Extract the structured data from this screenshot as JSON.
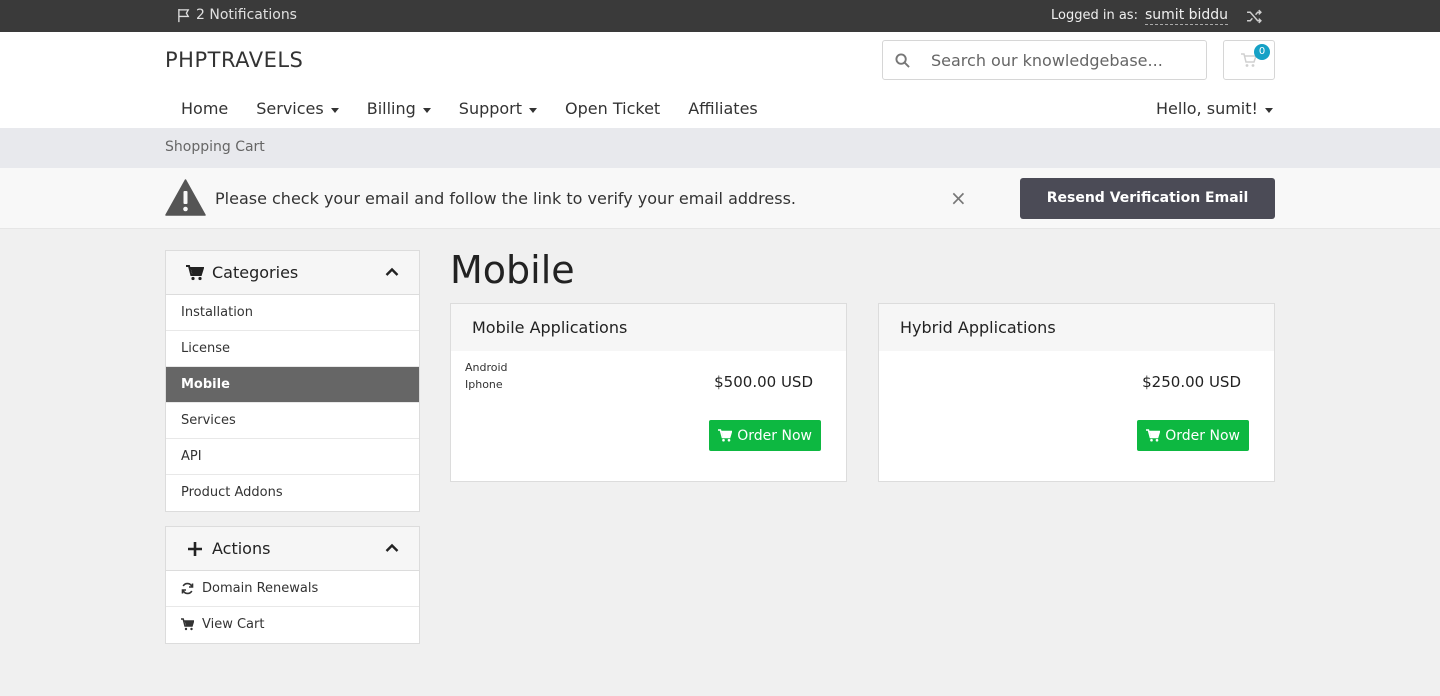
{
  "topbar": {
    "notifications": "2 Notifications",
    "logged_label": "Logged in as:",
    "user": "sumit biddu"
  },
  "header": {
    "brand": "PHPTRAVELS",
    "search_placeholder": "Search our knowledgebase...",
    "cart_count": "0",
    "nav": [
      {
        "label": "Home",
        "dropdown": false
      },
      {
        "label": "Services",
        "dropdown": true
      },
      {
        "label": "Billing",
        "dropdown": true
      },
      {
        "label": "Support",
        "dropdown": true
      },
      {
        "label": "Open Ticket",
        "dropdown": false
      },
      {
        "label": "Affiliates",
        "dropdown": false
      }
    ],
    "hello": "Hello, sumit!"
  },
  "breadcrumb": "Shopping Cart",
  "alert": {
    "text": "Please check your email and follow the link to verify your email address.",
    "close": "×",
    "button": "Resend Verification Email"
  },
  "sidebar": {
    "categories": {
      "title": "Categories",
      "items": [
        "Installation",
        "License",
        "Mobile",
        "Services",
        "API",
        "Product Addons"
      ],
      "active": "Mobile"
    },
    "actions": {
      "title": "Actions",
      "items": [
        {
          "label": "Domain Renewals",
          "icon": "refresh-icon"
        },
        {
          "label": "View Cart",
          "icon": "cart-icon"
        }
      ]
    }
  },
  "main": {
    "title": "Mobile",
    "products": [
      {
        "name": "Mobile Applications",
        "features": [
          "Android",
          "Iphone"
        ],
        "price": "$500.00 USD",
        "button": "Order Now"
      },
      {
        "name": "Hybrid Applications",
        "features": [],
        "price": "$250.00 USD",
        "button": "Order Now"
      }
    ]
  },
  "colors": {
    "topbar": "#3a3a3a",
    "order_button": "#0db841",
    "resend_button": "#4b4b56",
    "active_category": "#666666",
    "cart_badge": "#16a1c6"
  }
}
